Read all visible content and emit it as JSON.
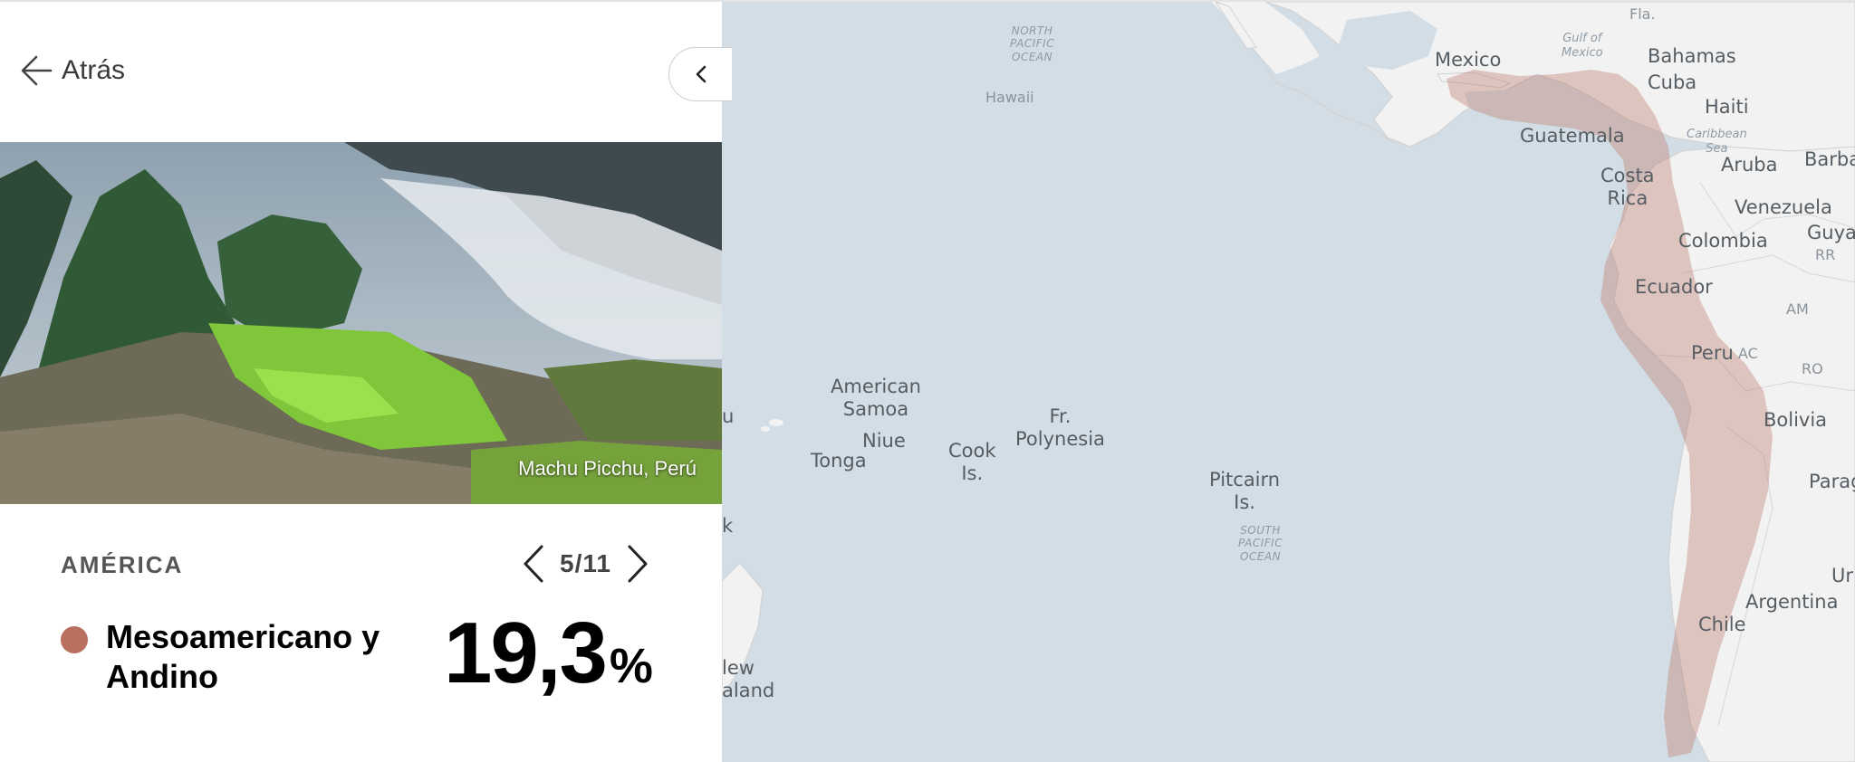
{
  "nav": {
    "back_label": "Atrás"
  },
  "hero": {
    "caption": "Machu Picchu, Perú"
  },
  "region": {
    "name": "AMÉRICA",
    "pager": "5/11"
  },
  "stat": {
    "label": "Mesoamericano y Andino",
    "value": "19,3",
    "unit": "%",
    "color": "#b9705f"
  },
  "map": {
    "labels": {
      "north_pacific": [
        "NORTH",
        "PACIFIC",
        "OCEAN"
      ],
      "south_pacific": [
        "SOUTH",
        "PACIFIC",
        "OCEAN"
      ],
      "hawaii": "Hawaii",
      "american_samoa": [
        "American",
        "Samoa"
      ],
      "niue": "Niue",
      "tonga": "Tonga",
      "cook": [
        "Cook",
        "Is."
      ],
      "polynesia": [
        "Fr.",
        "Polynesia"
      ],
      "pitcairn": [
        "Pitcairn",
        "Is."
      ],
      "new_zealand": [
        "lew",
        "aland"
      ],
      "edge_u": "u",
      "edge_k": "k",
      "fla": "Fla.",
      "gulf": [
        "Gulf of",
        "Mexico"
      ],
      "mexico": "Mexico",
      "bahamas": "Bahamas",
      "cuba": "Cuba",
      "haiti": "Haiti",
      "caribbean": [
        "Caribbean",
        "Sea"
      ],
      "guatemala": "Guatemala",
      "aruba": "Aruba",
      "barba": "Barba",
      "costa_rica": [
        "Costa",
        "Rica"
      ],
      "venezuela": "Venezuela",
      "guya": "Guya",
      "rr": "RR",
      "colombia": "Colombia",
      "ecuador": "Ecuador",
      "am": "AM",
      "peru": "Peru",
      "ac": "AC",
      "ro": "RO",
      "bolivia": "Bolivia",
      "parag": "Parag",
      "ur": "Ur",
      "argentina": "Argentina",
      "chile": "Chile"
    }
  }
}
